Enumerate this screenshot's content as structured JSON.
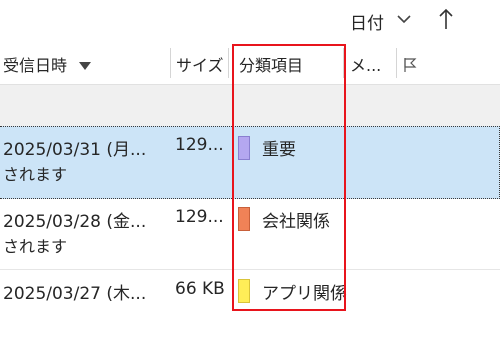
{
  "sort_bar": {
    "sort_label": "日付",
    "chevron_icon": "chevron-down-icon",
    "direction_icon": "arrow-up-icon"
  },
  "columns": {
    "received": "受信日時",
    "received_sort_icon": "sort-down-triangle-icon",
    "size": "サイズ",
    "category": "分類項目",
    "mention": "メ...",
    "flag_icon": "flag-icon"
  },
  "messages": [
    {
      "received": "2025/03/31 (月...",
      "preview": "されます",
      "size": "129...",
      "category": {
        "name": "重要",
        "color": "#b4a7f0",
        "border": "#8a7fd0"
      },
      "selected": true
    },
    {
      "received": "2025/03/28 (金...",
      "preview": "されます",
      "size": "129...",
      "category": {
        "name": "会社関係",
        "color": "#f08257",
        "border": "#c8603a"
      },
      "selected": false
    },
    {
      "received": "2025/03/27 (木...",
      "preview": "",
      "size": "66 KB",
      "category": {
        "name": "アプリ関係",
        "color": "#ffee58",
        "border": "#d9c43a"
      },
      "selected": false
    }
  ],
  "colors": {
    "selected_row": "#cce4f7",
    "highlight_border": "#e8141c"
  }
}
